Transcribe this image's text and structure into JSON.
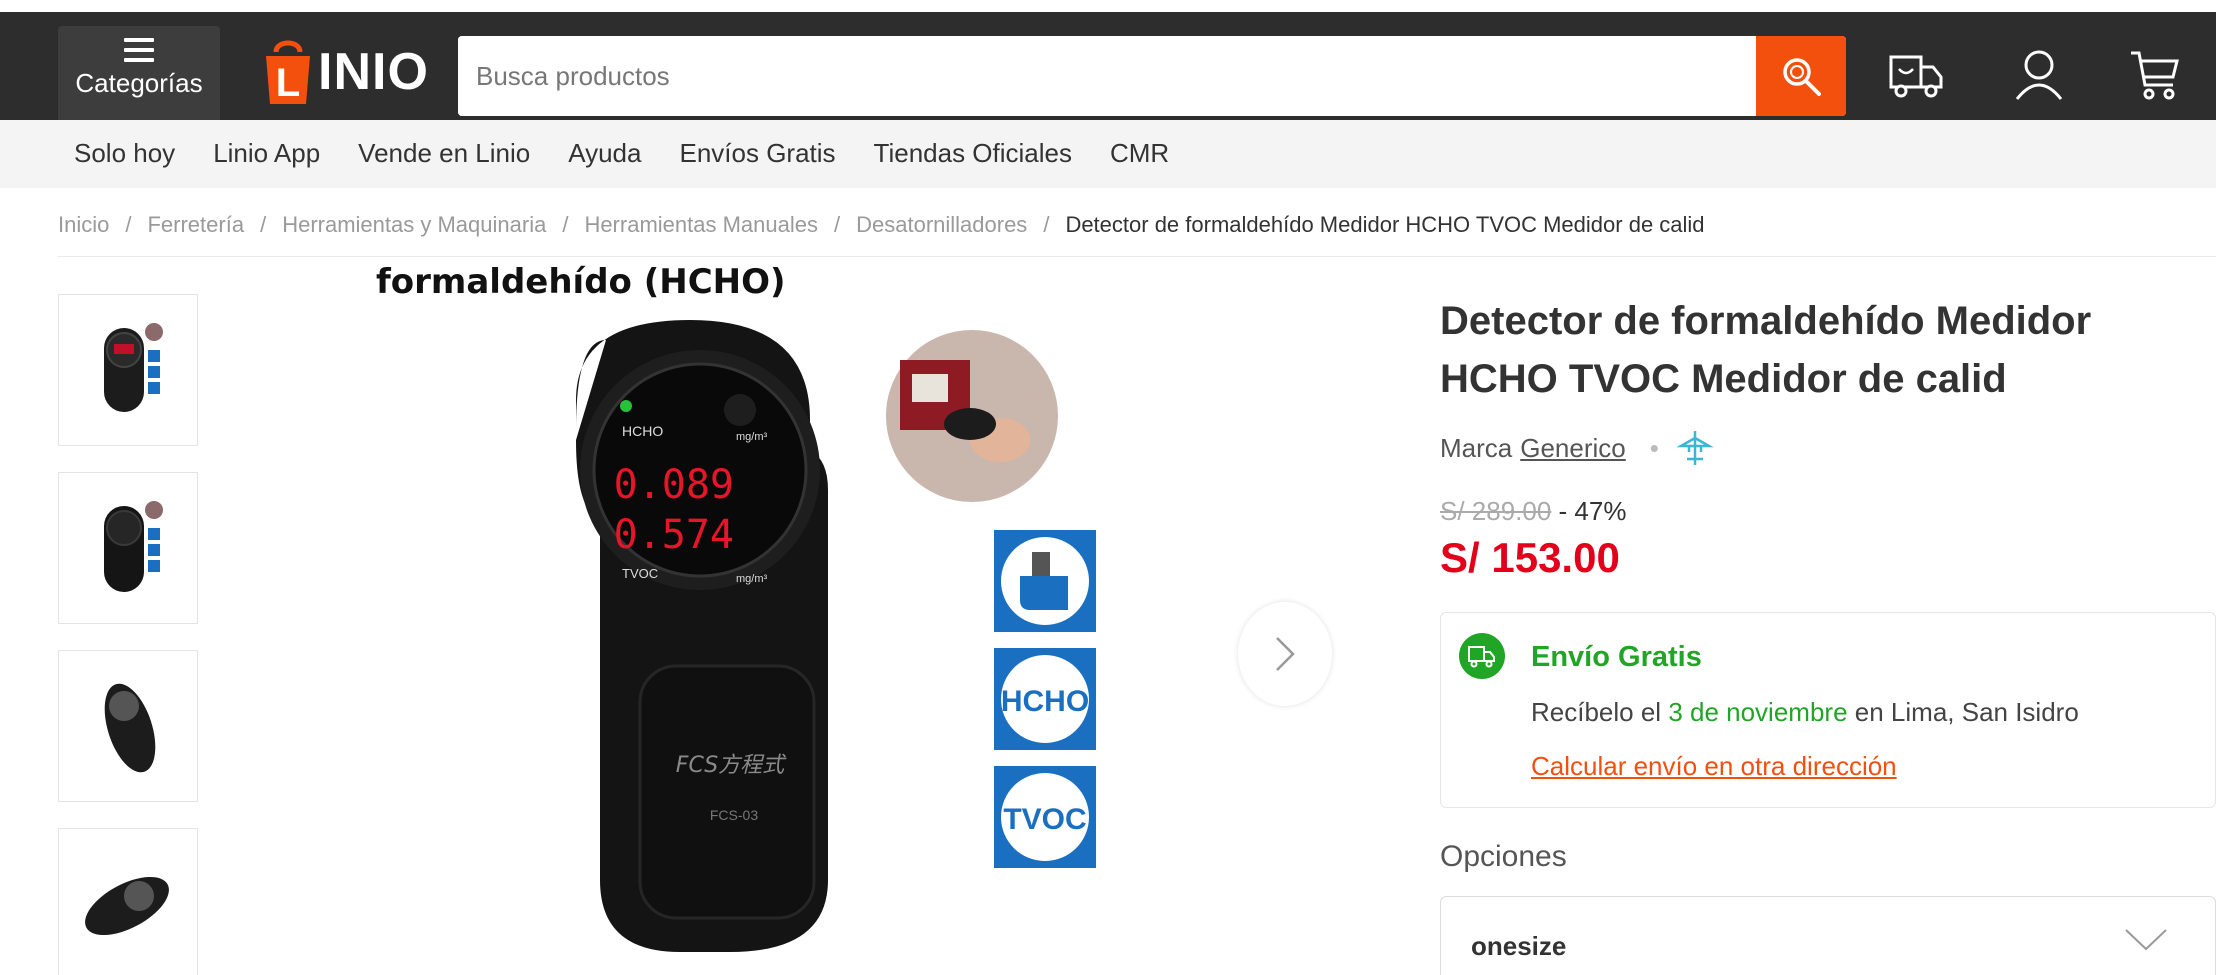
{
  "header": {
    "categories_label": "Categorías",
    "logo_text": "INIO",
    "logo_bag_letter": "L",
    "search_placeholder": "Busca productos",
    "accent_color": "#f34f0d"
  },
  "nav": {
    "items": [
      "Solo hoy",
      "Linio App",
      "Vende en Linio",
      "Ayuda",
      "Envíos Gratis",
      "Tiendas Oficiales",
      "CMR"
    ]
  },
  "breadcrumb": {
    "items": [
      "Inicio",
      "Ferretería",
      "Herramientas y Maquinaria",
      "Herramientas Manuales",
      "Desatornilladores"
    ],
    "separator": "/",
    "current": "Detector de formaldehído Medidor HCHO TVOC Medidor de calid"
  },
  "gallery": {
    "overlay_caption": "formaldehído (HCHO)",
    "device": {
      "label_top": "HCHO",
      "unit": "mg/m³",
      "reading_1": "0.089",
      "reading_2": "0.574",
      "label_bottom": "TVOC",
      "brand_mark": "FCS方程式",
      "model": "FCS-03"
    },
    "badges": [
      "HCHO",
      "TVOC"
    ],
    "thumbnail_count": 4
  },
  "product": {
    "title": "Detector de formaldehído Medidor HCHO TVOC Medidor de calid",
    "brand_prefix": "Marca",
    "brand_name": "Generico",
    "old_price": "S/ 289.00",
    "discount": "- 47%",
    "price": "S/ 153.00",
    "price_color": "#e3001b"
  },
  "shipping": {
    "title": "Envío Gratis",
    "line_prefix": "Recíbelo el",
    "date": "3 de noviembre",
    "line_suffix": "en Lima, San Isidro",
    "calc_link": "Calcular envío en otra dirección",
    "color": "#21a526"
  },
  "options": {
    "label": "Opciones",
    "selected": "onesize"
  }
}
